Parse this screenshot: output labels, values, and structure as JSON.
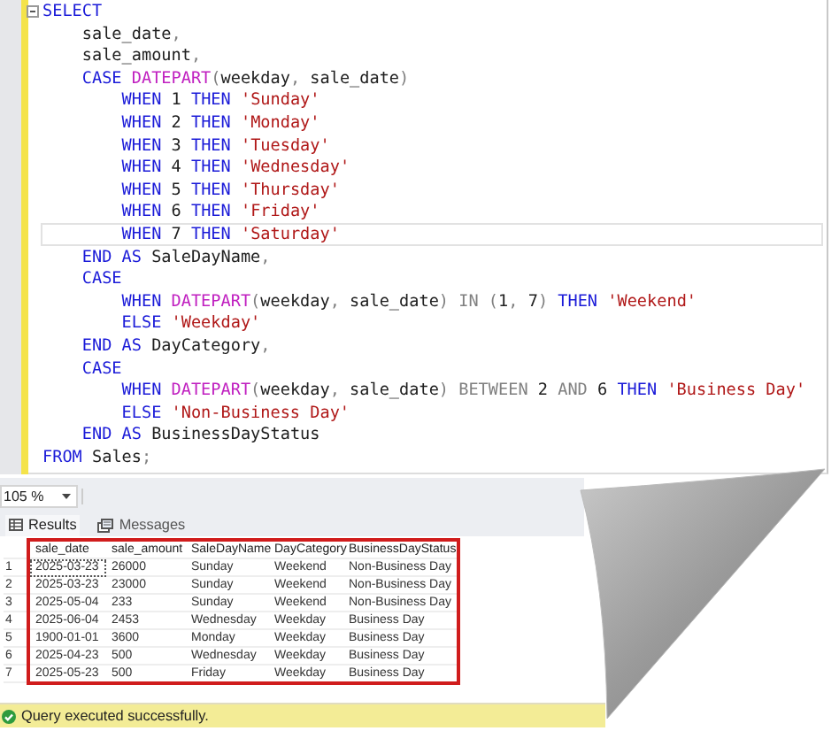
{
  "editor": {
    "lines": [
      {
        "current": false,
        "tokens": [
          {
            "kind": "kw",
            "t": "SELECT"
          }
        ]
      },
      {
        "current": false,
        "tokens": [
          {
            "kind": "plain",
            "t": "    sale_date"
          },
          {
            "kind": "op",
            "t": ","
          }
        ]
      },
      {
        "current": false,
        "tokens": [
          {
            "kind": "plain",
            "t": "    sale_amount"
          },
          {
            "kind": "op",
            "t": ","
          }
        ]
      },
      {
        "current": false,
        "tokens": [
          {
            "kind": "kw",
            "t": "    CASE "
          },
          {
            "kind": "fn",
            "t": "DATEPART"
          },
          {
            "kind": "op",
            "t": "("
          },
          {
            "kind": "plain",
            "t": "weekday"
          },
          {
            "kind": "op",
            "t": ", "
          },
          {
            "kind": "plain",
            "t": "sale_date"
          },
          {
            "kind": "op",
            "t": ")"
          }
        ]
      },
      {
        "current": false,
        "tokens": [
          {
            "kind": "kw",
            "t": "        WHEN "
          },
          {
            "kind": "plain",
            "t": "1 "
          },
          {
            "kind": "kw",
            "t": "THEN "
          },
          {
            "kind": "str",
            "t": "'Sunday'"
          }
        ]
      },
      {
        "current": false,
        "tokens": [
          {
            "kind": "kw",
            "t": "        WHEN "
          },
          {
            "kind": "plain",
            "t": "2 "
          },
          {
            "kind": "kw",
            "t": "THEN "
          },
          {
            "kind": "str",
            "t": "'Monday'"
          }
        ]
      },
      {
        "current": false,
        "tokens": [
          {
            "kind": "kw",
            "t": "        WHEN "
          },
          {
            "kind": "plain",
            "t": "3 "
          },
          {
            "kind": "kw",
            "t": "THEN "
          },
          {
            "kind": "str",
            "t": "'Tuesday'"
          }
        ]
      },
      {
        "current": false,
        "tokens": [
          {
            "kind": "kw",
            "t": "        WHEN "
          },
          {
            "kind": "plain",
            "t": "4 "
          },
          {
            "kind": "kw",
            "t": "THEN "
          },
          {
            "kind": "str",
            "t": "'Wednesday'"
          }
        ]
      },
      {
        "current": false,
        "tokens": [
          {
            "kind": "kw",
            "t": "        WHEN "
          },
          {
            "kind": "plain",
            "t": "5 "
          },
          {
            "kind": "kw",
            "t": "THEN "
          },
          {
            "kind": "str",
            "t": "'Thursday'"
          }
        ]
      },
      {
        "current": false,
        "tokens": [
          {
            "kind": "kw",
            "t": "        WHEN "
          },
          {
            "kind": "plain",
            "t": "6 "
          },
          {
            "kind": "kw",
            "t": "THEN "
          },
          {
            "kind": "str",
            "t": "'Friday'"
          }
        ]
      },
      {
        "current": true,
        "tokens": [
          {
            "kind": "kw",
            "t": "        WHEN "
          },
          {
            "kind": "plain",
            "t": "7 "
          },
          {
            "kind": "kw",
            "t": "THEN "
          },
          {
            "kind": "str",
            "t": "'Saturday'"
          }
        ]
      },
      {
        "current": false,
        "tokens": [
          {
            "kind": "kw",
            "t": "    END AS "
          },
          {
            "kind": "plain",
            "t": "SaleDayName"
          },
          {
            "kind": "op",
            "t": ","
          }
        ]
      },
      {
        "current": false,
        "tokens": [
          {
            "kind": "kw",
            "t": "    CASE"
          }
        ]
      },
      {
        "current": false,
        "tokens": [
          {
            "kind": "kw",
            "t": "        WHEN "
          },
          {
            "kind": "fn",
            "t": "DATEPART"
          },
          {
            "kind": "op",
            "t": "("
          },
          {
            "kind": "plain",
            "t": "weekday"
          },
          {
            "kind": "op",
            "t": ", "
          },
          {
            "kind": "plain",
            "t": "sale_date"
          },
          {
            "kind": "op",
            "t": ") IN ("
          },
          {
            "kind": "plain",
            "t": "1"
          },
          {
            "kind": "op",
            "t": ", "
          },
          {
            "kind": "plain",
            "t": "7"
          },
          {
            "kind": "op",
            "t": ") "
          },
          {
            "kind": "kw",
            "t": "THEN "
          },
          {
            "kind": "str",
            "t": "'Weekend'"
          }
        ]
      },
      {
        "current": false,
        "tokens": [
          {
            "kind": "kw",
            "t": "        ELSE "
          },
          {
            "kind": "str",
            "t": "'Weekday'"
          }
        ]
      },
      {
        "current": false,
        "tokens": [
          {
            "kind": "kw",
            "t": "    END AS "
          },
          {
            "kind": "plain",
            "t": "DayCategory"
          },
          {
            "kind": "op",
            "t": ","
          }
        ]
      },
      {
        "current": false,
        "tokens": [
          {
            "kind": "kw",
            "t": "    CASE"
          }
        ]
      },
      {
        "current": false,
        "tokens": [
          {
            "kind": "kw",
            "t": "        WHEN "
          },
          {
            "kind": "fn",
            "t": "DATEPART"
          },
          {
            "kind": "op",
            "t": "("
          },
          {
            "kind": "plain",
            "t": "weekday"
          },
          {
            "kind": "op",
            "t": ", "
          },
          {
            "kind": "plain",
            "t": "sale_date"
          },
          {
            "kind": "op",
            "t": ") BETWEEN "
          },
          {
            "kind": "plain",
            "t": "2 "
          },
          {
            "kind": "op",
            "t": "AND "
          },
          {
            "kind": "plain",
            "t": "6 "
          },
          {
            "kind": "kw",
            "t": "THEN "
          },
          {
            "kind": "str",
            "t": "'Business Day'"
          }
        ]
      },
      {
        "current": false,
        "tokens": [
          {
            "kind": "kw",
            "t": "        ELSE "
          },
          {
            "kind": "str",
            "t": "'Non-Business Day'"
          }
        ]
      },
      {
        "current": false,
        "tokens": [
          {
            "kind": "kw",
            "t": "    END AS "
          },
          {
            "kind": "plain",
            "t": "BusinessDayStatus"
          }
        ]
      },
      {
        "current": false,
        "tokens": [
          {
            "kind": "kw",
            "t": "FROM "
          },
          {
            "kind": "plain",
            "t": "Sales"
          },
          {
            "kind": "op",
            "t": ";"
          }
        ]
      }
    ]
  },
  "zoom": {
    "value": "105 %"
  },
  "tabs": [
    {
      "label": "Results",
      "selected": true
    },
    {
      "label": "Messages",
      "selected": false
    }
  ],
  "results": {
    "columns": [
      "sale_date",
      "sale_amount",
      "SaleDayName",
      "DayCategory",
      "BusinessDayStatus"
    ],
    "rows": [
      {
        "number": "1",
        "focused": true,
        "cells": [
          "2025-03-23",
          "26000",
          "Sunday",
          "Weekend",
          "Non-Business Day"
        ]
      },
      {
        "number": "2",
        "focused": false,
        "cells": [
          "2025-03-23",
          "23000",
          "Sunday",
          "Weekend",
          "Non-Business Day"
        ]
      },
      {
        "number": "3",
        "focused": false,
        "cells": [
          "2025-05-04",
          "233",
          "Sunday",
          "Weekend",
          "Non-Business Day"
        ]
      },
      {
        "number": "4",
        "focused": false,
        "cells": [
          "2025-06-04",
          "2453",
          "Wednesday",
          "Weekday",
          "Business Day"
        ]
      },
      {
        "number": "5",
        "focused": false,
        "cells": [
          "1900-01-01",
          "3600",
          "Monday",
          "Weekday",
          "Business Day"
        ]
      },
      {
        "number": "6",
        "focused": false,
        "cells": [
          "2025-04-23",
          "500",
          "Wednesday",
          "Weekday",
          "Business Day"
        ]
      },
      {
        "number": "7",
        "focused": false,
        "cells": [
          "2025-05-23",
          "500",
          "Friday",
          "Weekday",
          "Business Day"
        ]
      }
    ]
  },
  "status_bar": {
    "message": "Query executed successfully."
  }
}
